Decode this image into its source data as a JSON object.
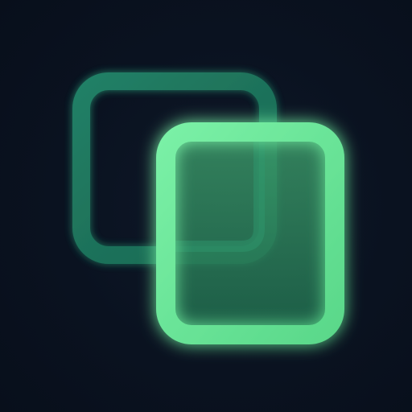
{
  "icon": {
    "name": "copy-icon",
    "colors": {
      "background": "#0a1220",
      "back_square_stroke": "#1f7a5a",
      "front_square_stroke": "#6fe89a",
      "front_square_fill_top": "#3e9f6c",
      "front_square_fill_bottom": "#1f6b4d",
      "glow": "#4fdc8a"
    }
  }
}
